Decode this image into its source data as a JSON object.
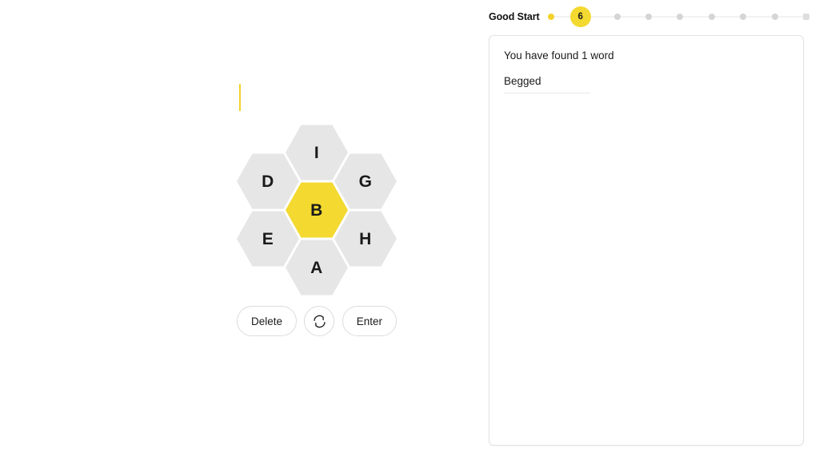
{
  "puzzle": {
    "input_value": "",
    "cursor_visible": true,
    "center_letter": "B",
    "outer_letters": [
      "I",
      "G",
      "H",
      "A",
      "E",
      "D"
    ],
    "hive": [
      {
        "pos": "top",
        "letter": "I",
        "center": false
      },
      {
        "pos": "ul",
        "letter": "D",
        "center": false
      },
      {
        "pos": "ur",
        "letter": "G",
        "center": false
      },
      {
        "pos": "center",
        "letter": "B",
        "center": true
      },
      {
        "pos": "ll",
        "letter": "E",
        "center": false
      },
      {
        "pos": "lr",
        "letter": "H",
        "center": false
      },
      {
        "pos": "bottom",
        "letter": "A",
        "center": false
      }
    ],
    "controls": {
      "delete_label": "Delete",
      "shuffle_icon": "shuffle-icon",
      "enter_label": "Enter"
    },
    "colors": {
      "center_hex": "#f3d930",
      "outer_hex": "#e6e6e6",
      "cursor": "#f3d22d"
    }
  },
  "progress": {
    "rank_label": "Good Start",
    "current_score": "6",
    "ticks": [
      {
        "state": "done",
        "shape": "circle"
      },
      {
        "state": "current",
        "shape": "circle",
        "label": "6"
      },
      {
        "state": "todo",
        "shape": "circle"
      },
      {
        "state": "todo",
        "shape": "circle"
      },
      {
        "state": "todo",
        "shape": "circle"
      },
      {
        "state": "todo",
        "shape": "circle"
      },
      {
        "state": "todo",
        "shape": "circle"
      },
      {
        "state": "todo",
        "shape": "circle"
      },
      {
        "state": "todo",
        "shape": "square"
      }
    ]
  },
  "words": {
    "found_text": "You have found 1 word",
    "list": [
      "Begged"
    ]
  }
}
